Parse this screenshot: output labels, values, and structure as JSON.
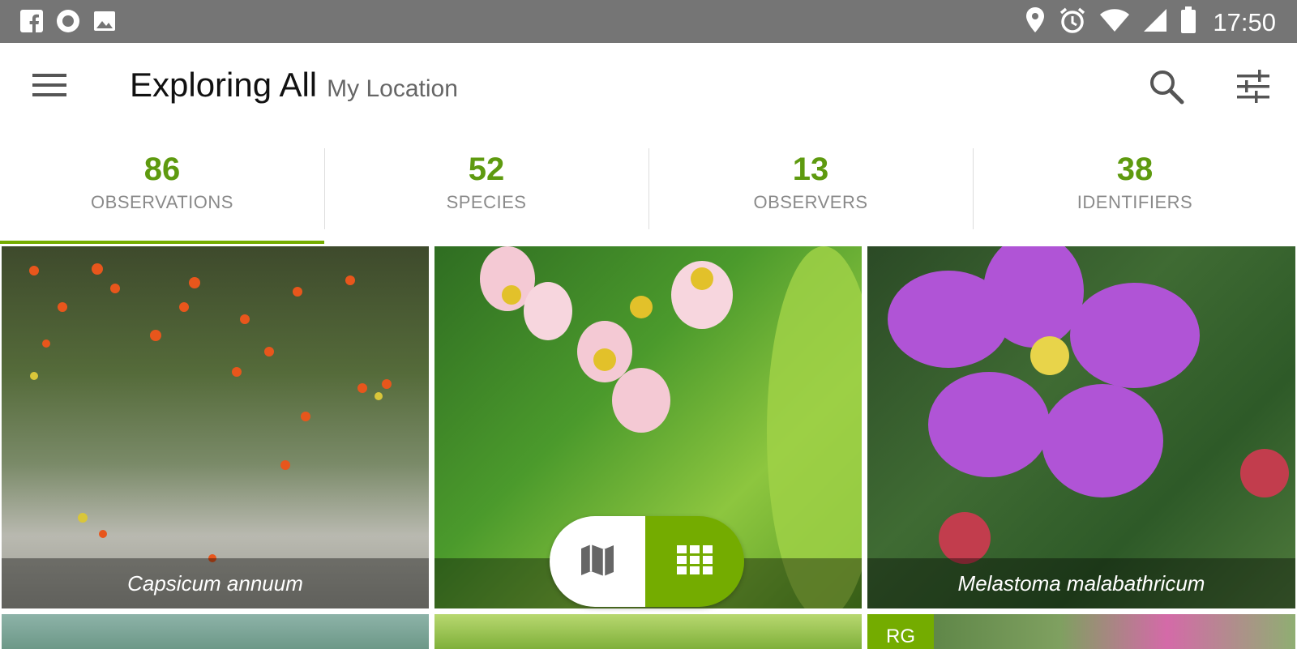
{
  "status_bar": {
    "time": "17:50",
    "left_icons": [
      "facebook-icon",
      "circle-notification-icon",
      "image-icon"
    ],
    "right_icons": [
      "location-pin-icon",
      "alarm-icon",
      "wifi-icon",
      "signal-icon",
      "battery-icon"
    ]
  },
  "header": {
    "title": "Exploring All",
    "subtitle": "My Location",
    "menu_icon": "hamburger-menu-icon",
    "search_icon": "search-icon",
    "filter_icon": "filter-sliders-icon"
  },
  "stats": [
    {
      "count": "86",
      "label": "OBSERVATIONS"
    },
    {
      "count": "52",
      "label": "SPECIES"
    },
    {
      "count": "13",
      "label": "OBSERVERS"
    },
    {
      "count": "38",
      "label": "IDENTIFIERS"
    }
  ],
  "grid": {
    "tiles": [
      {
        "caption": "Capsicum annuum"
      },
      {
        "caption": ""
      },
      {
        "caption": "Melastoma malabathricum"
      }
    ],
    "badge": "RG"
  },
  "view_toggle": {
    "map_icon": "map-icon",
    "grid_icon": "grid-icon",
    "selected": "grid"
  },
  "colors": {
    "accent": "#74ac00",
    "stat_number": "#5e9a0f",
    "status_bar": "#757575"
  }
}
